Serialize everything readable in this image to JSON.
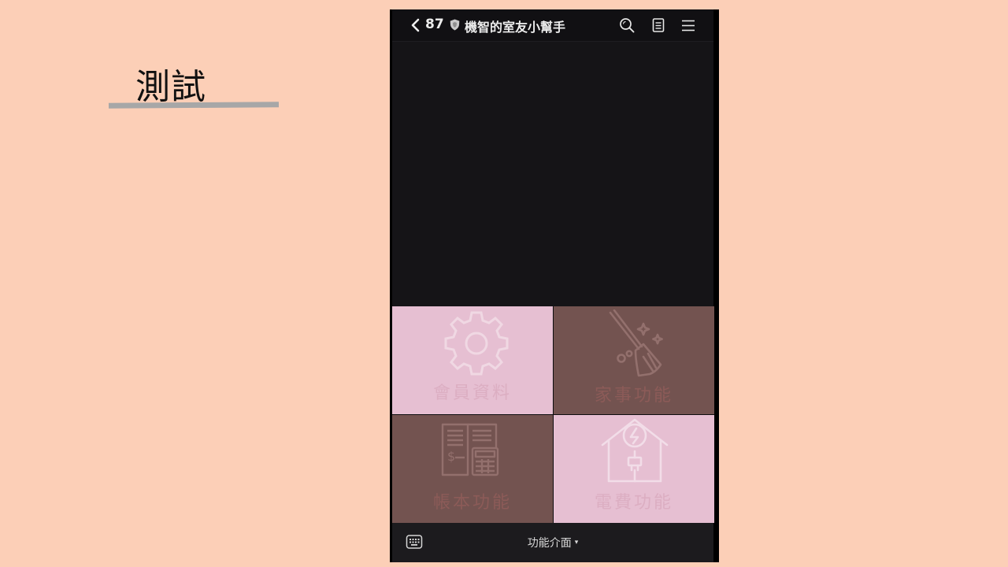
{
  "slide": {
    "title": "測試"
  },
  "header": {
    "back_icon": "chevron-left-icon",
    "unread_count": "87",
    "chat_name": "機智的室友小幫手",
    "icons": [
      "search-icon",
      "note-icon",
      "hamburger-menu-icon"
    ]
  },
  "rich_menu": {
    "tiles": [
      {
        "label": "會員資料",
        "icon": "gear-icon",
        "color": "#e6bfd2"
      },
      {
        "label": "家事功能",
        "icon": "broom-icon",
        "color": "#735350"
      },
      {
        "label": "帳本功能",
        "icon": "ledger-calculator-icon",
        "color": "#735350"
      },
      {
        "label": "電費功能",
        "icon": "house-plug-icon",
        "color": "#e6bfd2"
      }
    ]
  },
  "bottom_bar": {
    "keyboard_icon": "keyboard-icon",
    "menu_label": "功能介面",
    "caret": "▾"
  },
  "colors": {
    "background": "#fccfb7",
    "chat_bg": "#151417",
    "tile_pink": "#e6bfd2",
    "tile_brown": "#735350"
  }
}
